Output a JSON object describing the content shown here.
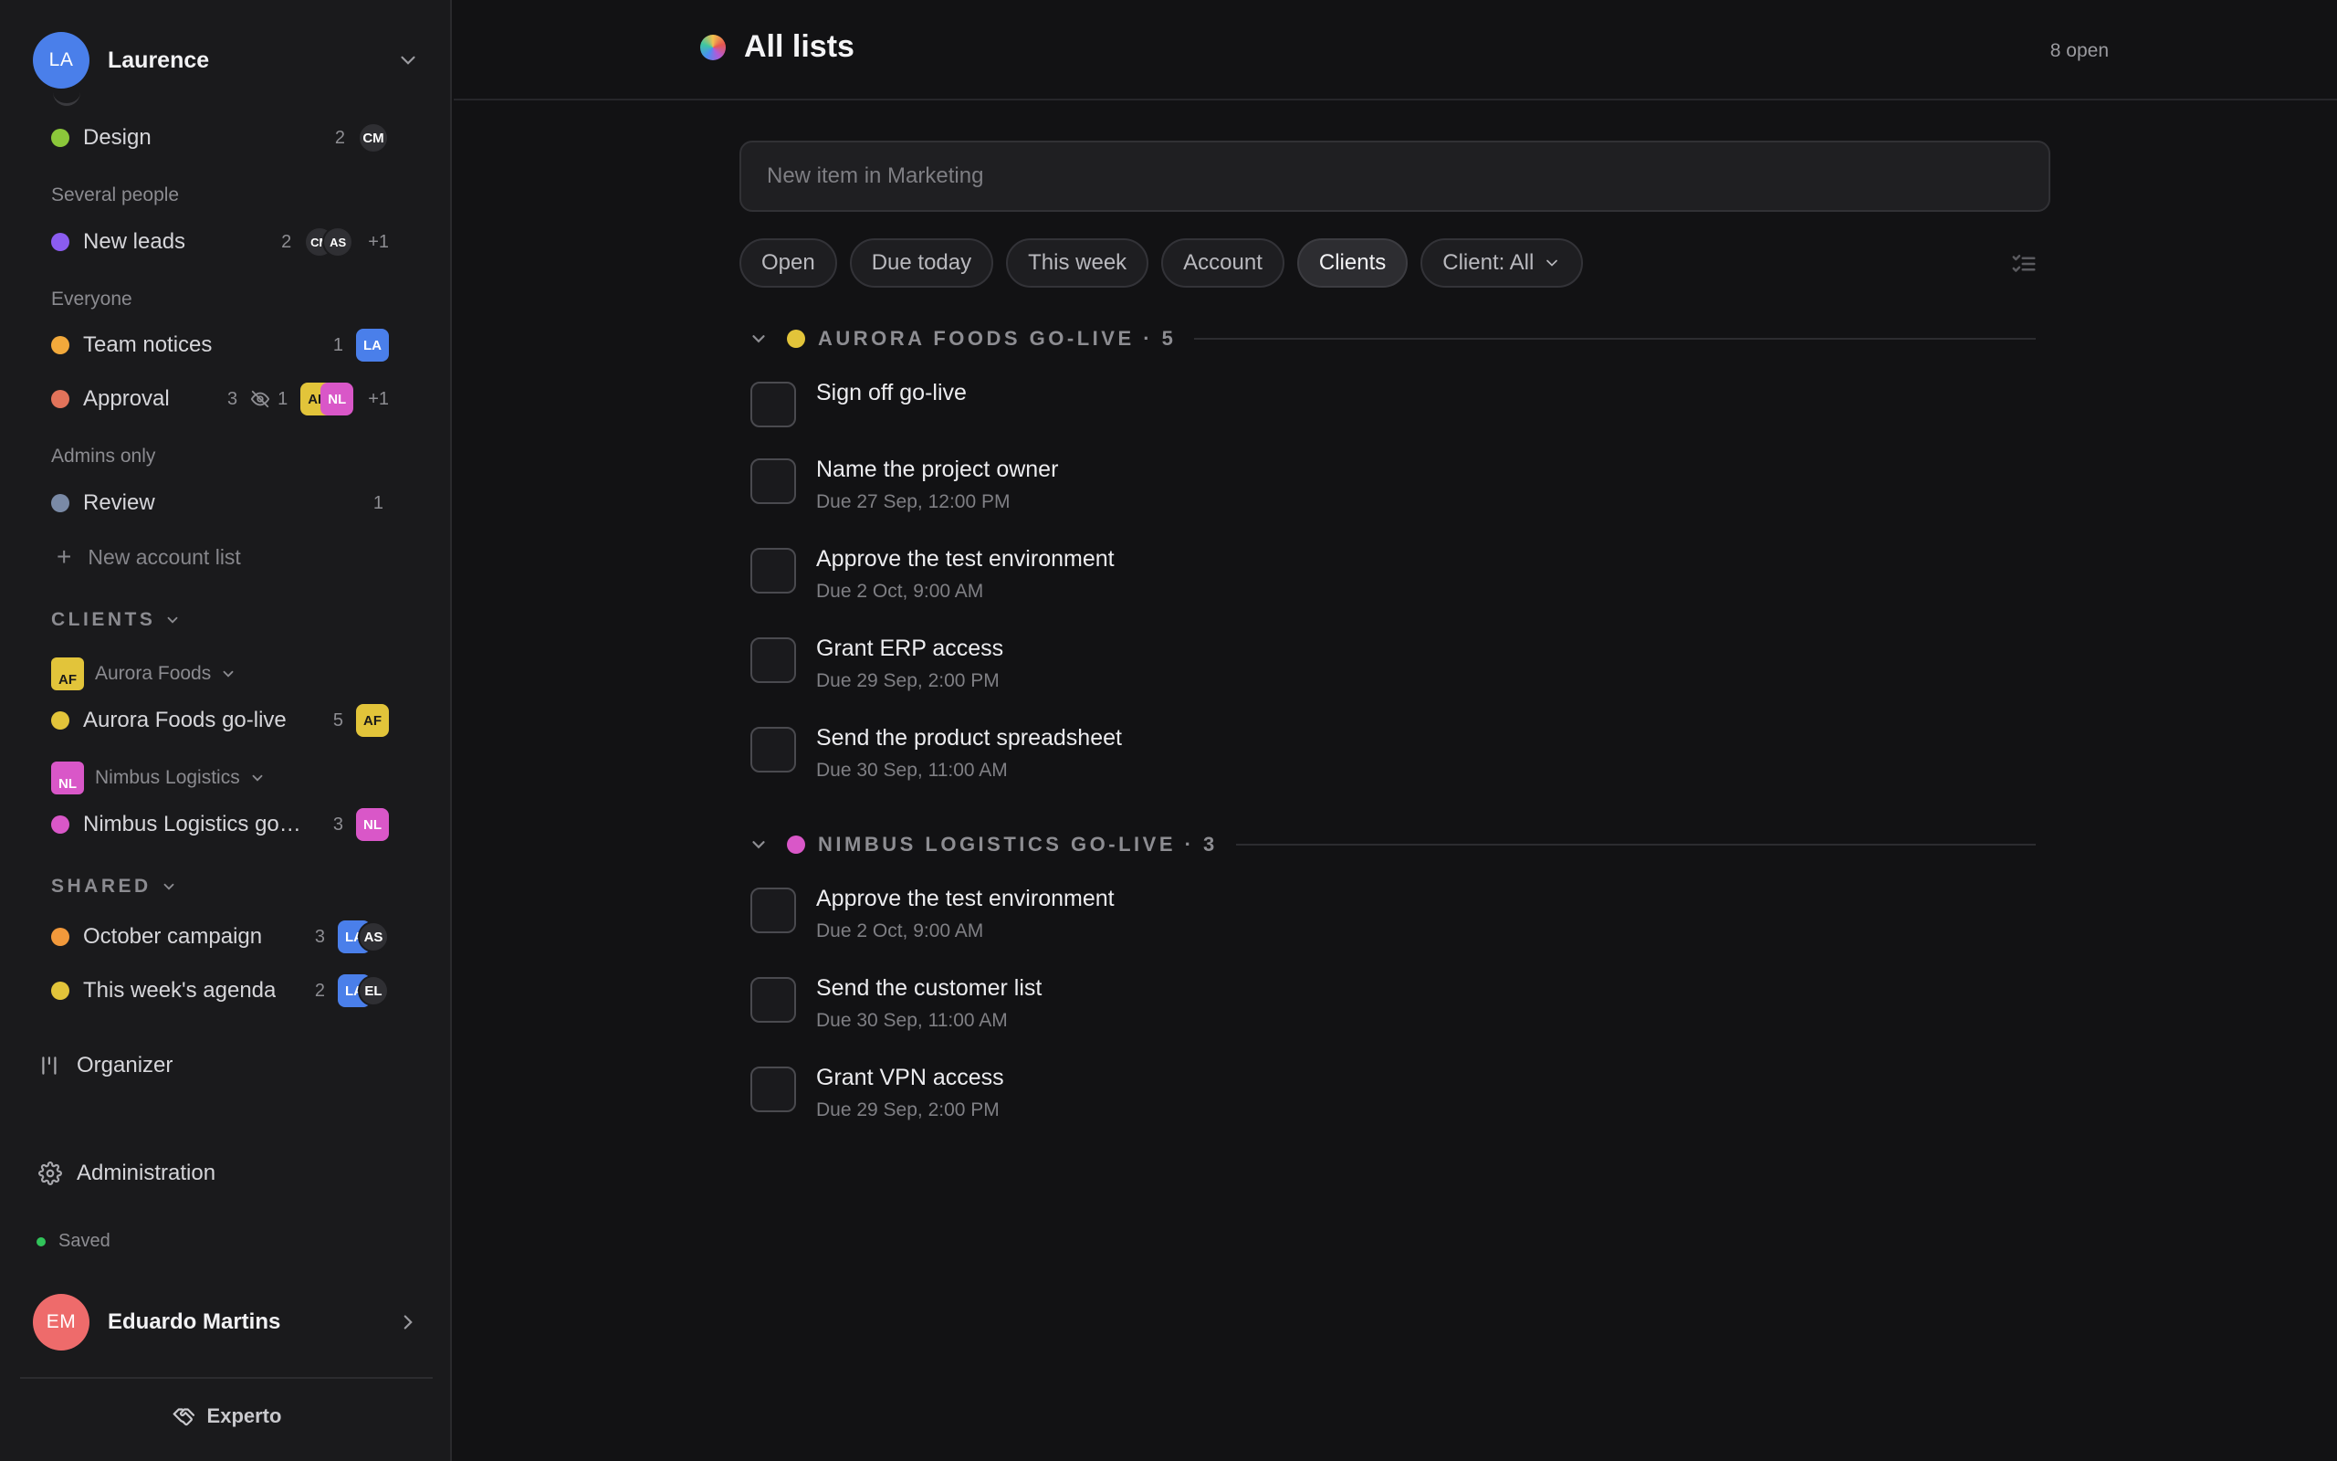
{
  "account": {
    "initials": "LA",
    "name": "Laurence",
    "avatar_color": "#4a7fea"
  },
  "sidebar": {
    "lists": [
      {
        "id": "design",
        "name": "Design",
        "color": "#8bc73a",
        "count": "2",
        "avatars": [
          {
            "initials": "CM",
            "color": "#2f2f33",
            "shape": "circle"
          }
        ]
      },
      {
        "id": "new-leads",
        "name": "New leads",
        "color": "#8b5cf0",
        "count": "2",
        "avatars": [
          {
            "initials": "CM",
            "color": "#2f2f33",
            "shape": "circle"
          },
          {
            "initials": "AS",
            "color": "#2f2f33",
            "shape": "circle"
          }
        ],
        "more": "+1"
      },
      {
        "id": "team-notices",
        "name": "Team notices",
        "color": "#f2a93b",
        "count": "1",
        "avatars": [
          {
            "initials": "LA",
            "color": "#4a7fea",
            "shape": "square"
          }
        ]
      },
      {
        "id": "approval",
        "name": "Approval",
        "color": "#e2735a",
        "count": "3",
        "hidden": "1",
        "avatars": [
          {
            "initials": "AF",
            "color": "#e2c43a",
            "shape": "square",
            "fg": "#1a1a1a"
          },
          {
            "initials": "NL",
            "color": "#d957c8",
            "shape": "square"
          }
        ],
        "more": "+1"
      },
      {
        "id": "review",
        "name": "Review",
        "color": "#7a8aa6",
        "count": "1",
        "avatars": []
      }
    ],
    "groups": {
      "several": "Several people",
      "everyone": "Everyone",
      "admins": "Admins only"
    },
    "new_account_list": "New account list",
    "clients_label": "CLIENTS",
    "clients": [
      {
        "initials": "AF",
        "name": "Aurora Foods",
        "color": "#e2c43a",
        "fg": "#1a1a1a",
        "list": {
          "name": "Aurora Foods go-live",
          "color": "#e2c43a",
          "count": "5",
          "badge": "AF"
        }
      },
      {
        "initials": "NL",
        "name": "Nimbus Logistics",
        "color": "#d957c8",
        "fg": "#ffffff",
        "list": {
          "name": "Nimbus Logistics go-live",
          "color": "#d957c8",
          "count": "3",
          "badge": "NL"
        }
      }
    ],
    "shared_label": "SHARED",
    "shared": [
      {
        "name": "October campaign",
        "color": "#f2993b",
        "count": "3",
        "avatars": [
          {
            "initials": "LA",
            "color": "#4a7fea",
            "shape": "square"
          },
          {
            "initials": "AS",
            "color": "#2f2f33",
            "shape": "circle"
          }
        ]
      },
      {
        "name": "This week's agenda",
        "color": "#e2c43a",
        "count": "2",
        "avatars": [
          {
            "initials": "LA",
            "color": "#4a7fea",
            "shape": "square"
          },
          {
            "initials": "EL",
            "color": "#2f2f33",
            "shape": "circle"
          }
        ]
      }
    ],
    "organizer": "Organizer",
    "administration": "Administration",
    "saved": "Saved",
    "user": {
      "initials": "EM",
      "name": "Eduardo Martins",
      "avatar_color": "#ee6b6b"
    },
    "brand": "Experto"
  },
  "main": {
    "title": "All lists",
    "open_count": "8 open",
    "new_item_placeholder": "New item in Marketing",
    "filters": [
      {
        "label": "Open",
        "active": false
      },
      {
        "label": "Due today",
        "active": false
      },
      {
        "label": "This week",
        "active": false
      },
      {
        "label": "Account",
        "active": false
      },
      {
        "label": "Clients",
        "active": true
      },
      {
        "label": "Client: All",
        "active": false,
        "dropdown": true
      }
    ],
    "groups": [
      {
        "title": "AURORA FOODS GO-LIVE · 5",
        "color": "#e2c43a",
        "tasks": [
          {
            "title": "Sign off go-live",
            "due": ""
          },
          {
            "title": "Name the project owner",
            "due": "Due 27 Sep, 12:00 PM"
          },
          {
            "title": "Approve the test environment",
            "due": "Due 2 Oct, 9:00 AM"
          },
          {
            "title": "Grant ERP access",
            "due": "Due 29 Sep, 2:00 PM"
          },
          {
            "title": "Send the product spreadsheet",
            "due": "Due 30 Sep, 11:00 AM"
          }
        ]
      },
      {
        "title": "NIMBUS LOGISTICS GO-LIVE · 3",
        "color": "#d957c8",
        "tasks": [
          {
            "title": "Approve the test environment",
            "due": "Due 2 Oct, 9:00 AM"
          },
          {
            "title": "Send the customer list",
            "due": "Due 30 Sep, 11:00 AM"
          },
          {
            "title": "Grant VPN access",
            "due": "Due 29 Sep, 2:00 PM"
          }
        ]
      }
    ]
  }
}
